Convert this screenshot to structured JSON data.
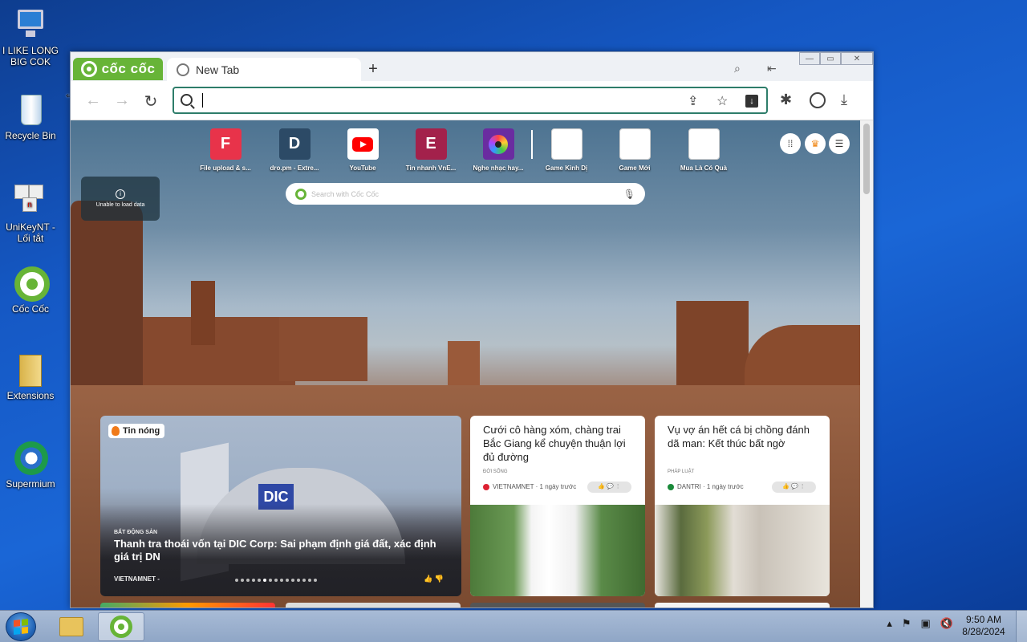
{
  "desktop": {
    "icons": [
      {
        "label": "I LIKE LONG\nBIG COK"
      },
      {
        "label": "Recycle Bin"
      },
      {
        "label": "UniKeyNT -\nLối tắt"
      },
      {
        "label": "Cốc Cốc"
      },
      {
        "label": "Extensions"
      },
      {
        "label": "Supermium"
      }
    ]
  },
  "browser": {
    "brand": "cốc cốc",
    "tab_title": "New Tab",
    "new_tab_symbol": "+",
    "omnibox_value": ""
  },
  "ntp": {
    "shortcuts": [
      {
        "letter": "F",
        "name": "File upload & s...",
        "color": "#e8334a"
      },
      {
        "letter": "D",
        "name": "dro.pm - Extre...",
        "color": "#2c4a66"
      },
      {
        "letter": "",
        "name": "YouTube",
        "color": "#ffffff"
      },
      {
        "letter": "E",
        "name": "Tin nhanh VnE...",
        "color": "#a3214b"
      },
      {
        "letter": "",
        "name": "Nghe nhạc hay...",
        "color": "#6a2ca0"
      },
      {
        "letter": "",
        "name": "Game Kinh Dị",
        "color": "#ffffff"
      },
      {
        "letter": "",
        "name": "Game Mới",
        "color": "#ffffff"
      },
      {
        "letter": "",
        "name": "Mua Là Có Quà",
        "color": "#ffffff"
      }
    ],
    "unable_text": "Unable to load data",
    "search_placeholder": "Search with Cốc Cốc",
    "feature": {
      "badge": "Tin nóng",
      "category": "BẤT ĐỘNG SẢN",
      "title": "Thanh tra thoái vốn tại DIC Corp: Sai phạm định giá đất, xác định giá trị DN",
      "source": "VIETNAMNET -",
      "logo_text": "DIC"
    },
    "news": [
      {
        "title": "Cưới cô hàng xóm, chàng trai Bắc Giang kể chuyện thuận lợi đủ đường",
        "category": "ĐỜI SỐNG",
        "source": "VIETNAMNET · 1 ngày trước"
      },
      {
        "title": "Vụ vợ án hết cá bị chồng đánh dã man: Kết thúc bất ngờ",
        "category": "PHÁP LUẬT",
        "source": "DANTRI · 1 ngày trước"
      }
    ]
  },
  "taskbar": {
    "time": "9:50 AM",
    "date": "8/28/2024"
  }
}
